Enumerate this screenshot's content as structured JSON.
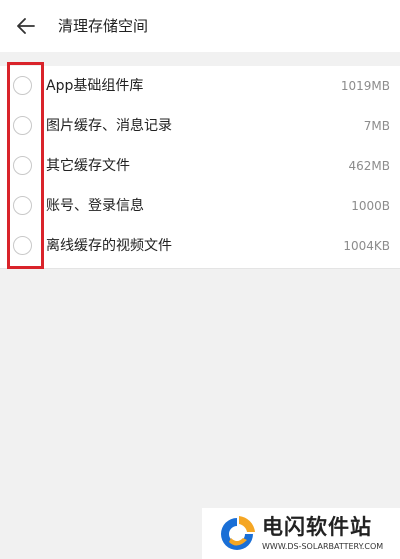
{
  "header": {
    "title": "清理存储空间",
    "back_icon": "arrow-left-icon"
  },
  "items": [
    {
      "label": "App基础组件库",
      "size": "1019MB",
      "checked": false
    },
    {
      "label": "图片缓存、消息记录",
      "size": "7MB",
      "checked": false
    },
    {
      "label": "其它缓存文件",
      "size": "462MB",
      "checked": false
    },
    {
      "label": "账号、登录信息",
      "size": "1000B",
      "checked": false
    },
    {
      "label": "离线缓存的视频文件",
      "size": "1004KB",
      "checked": false
    }
  ],
  "highlight_color": "#d9232a",
  "watermark": {
    "title": "电闪软件站",
    "url": "WWW.DS-SOLARBATTERY.COM",
    "logo_colors": [
      "#1a6fd6",
      "#f5a623"
    ]
  }
}
